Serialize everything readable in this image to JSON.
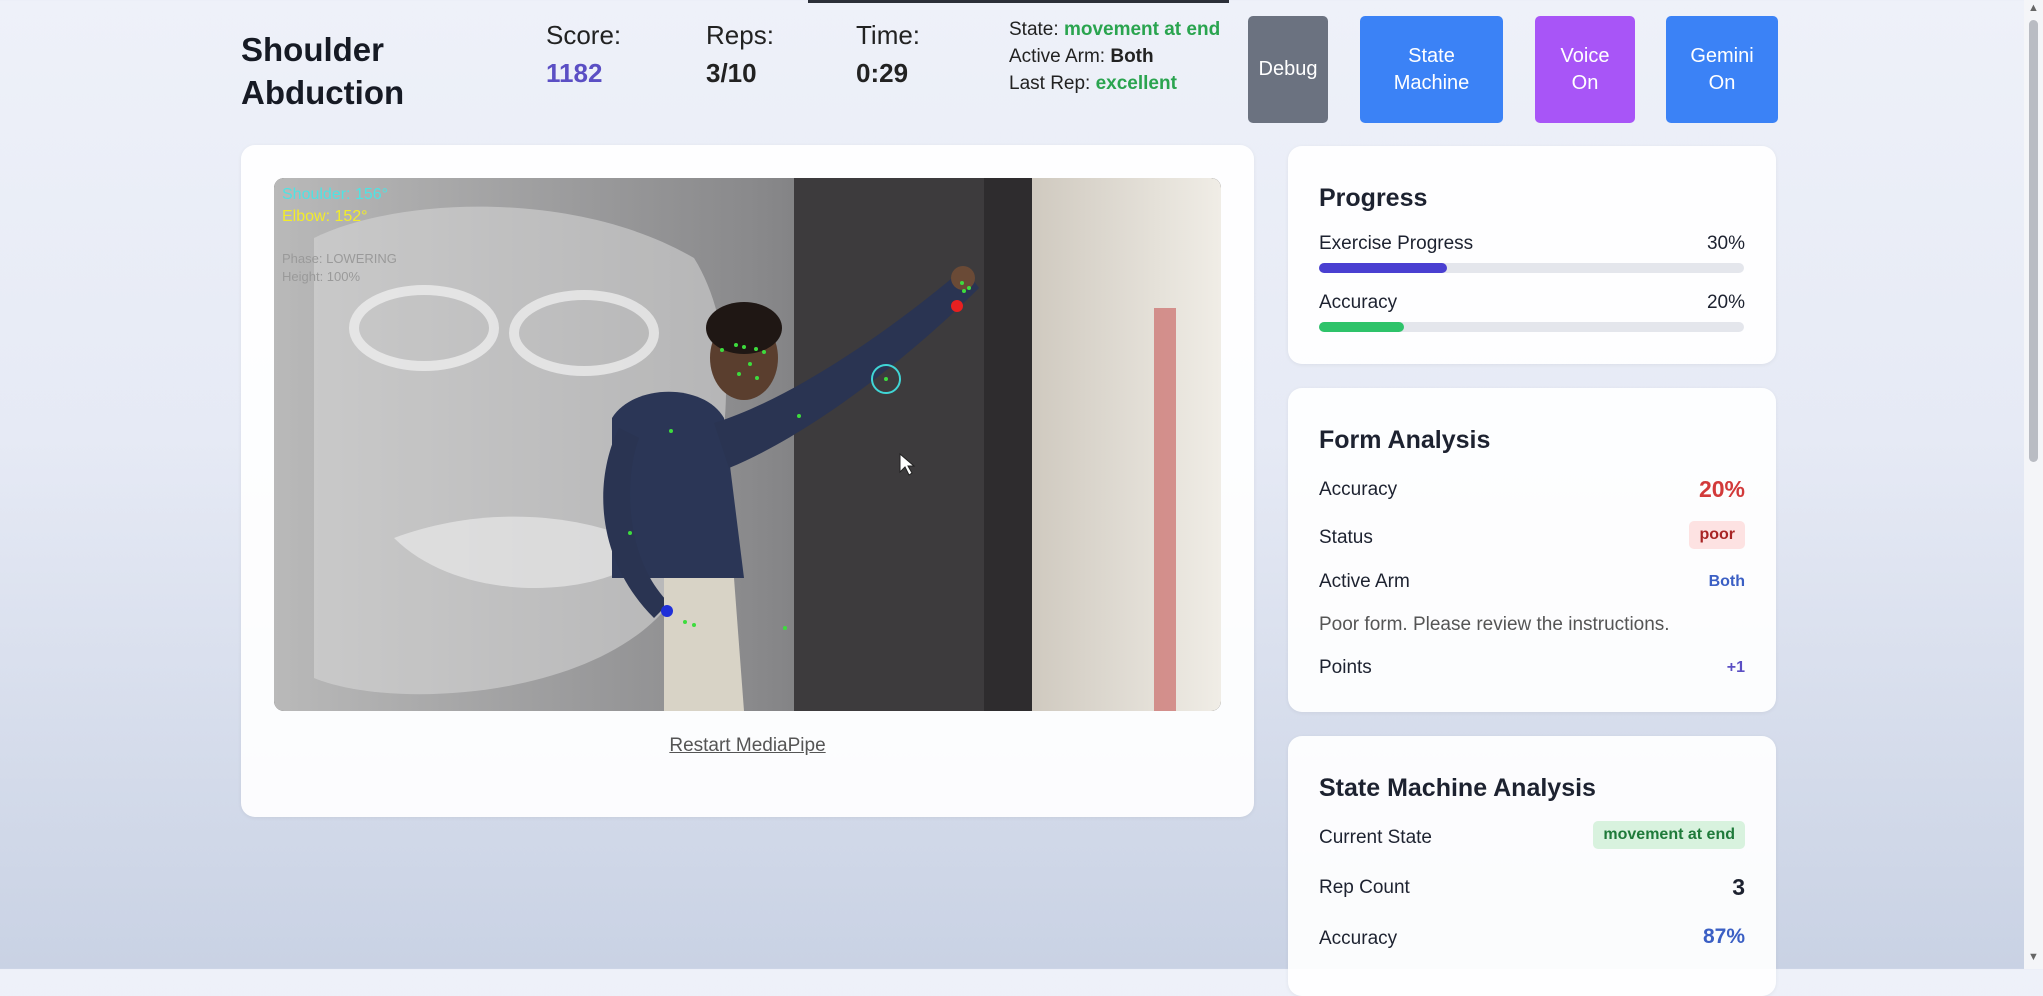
{
  "header": {
    "title": "Shoulder Abduction",
    "score_label": "Score:",
    "score_value": "1182",
    "reps_label": "Reps:",
    "reps_value": "3/10",
    "time_label": "Time:",
    "time_value": "0:29",
    "state_label": "State:",
    "state_value": "movement at end",
    "arm_label": "Active Arm:",
    "arm_value": "Both",
    "lastrep_label": "Last Rep:",
    "lastrep_value": "excellent",
    "buttons": {
      "debug": "Debug",
      "state_machine": "State Machine",
      "voice": "Voice On",
      "gemini": "Gemini On"
    }
  },
  "video": {
    "overlay_shoulder": "Shoulder: 156°",
    "overlay_elbow": "Elbow: 152°",
    "overlay_phase": "Phase: LOWERING",
    "overlay_height": "Height: 100%",
    "restart_link": "Restart MediaPipe"
  },
  "progress": {
    "title": "Progress",
    "exercise_label": "Exercise Progress",
    "exercise_value": "30%",
    "exercise_fraction": 0.3,
    "accuracy_label": "Accuracy",
    "accuracy_value": "20%",
    "accuracy_fraction": 0.2,
    "exercise_color": "#4a3fd1",
    "accuracy_color": "#2ec36a"
  },
  "form": {
    "title": "Form Analysis",
    "accuracy_label": "Accuracy",
    "accuracy_value": "20%",
    "status_label": "Status",
    "status_value": "poor",
    "arm_label": "Active Arm",
    "arm_value": "Both",
    "message": "Poor form. Please review the instructions.",
    "points_label": "Points",
    "points_value": "+1"
  },
  "state_machine": {
    "title": "State Machine Analysis",
    "current_label": "Current State",
    "current_value": "movement at end",
    "rep_label": "Rep Count",
    "rep_value": "3",
    "accuracy_label": "Accuracy",
    "accuracy_value": "87%"
  },
  "colors": {
    "debug_btn": "#6b7280",
    "state_btn": "#3b82f6",
    "voice_btn": "#a855f7",
    "gemini_btn": "#3b82f6",
    "green": "#2aa44f",
    "red": "#d23a3a",
    "blue": "#3b5fc4"
  }
}
